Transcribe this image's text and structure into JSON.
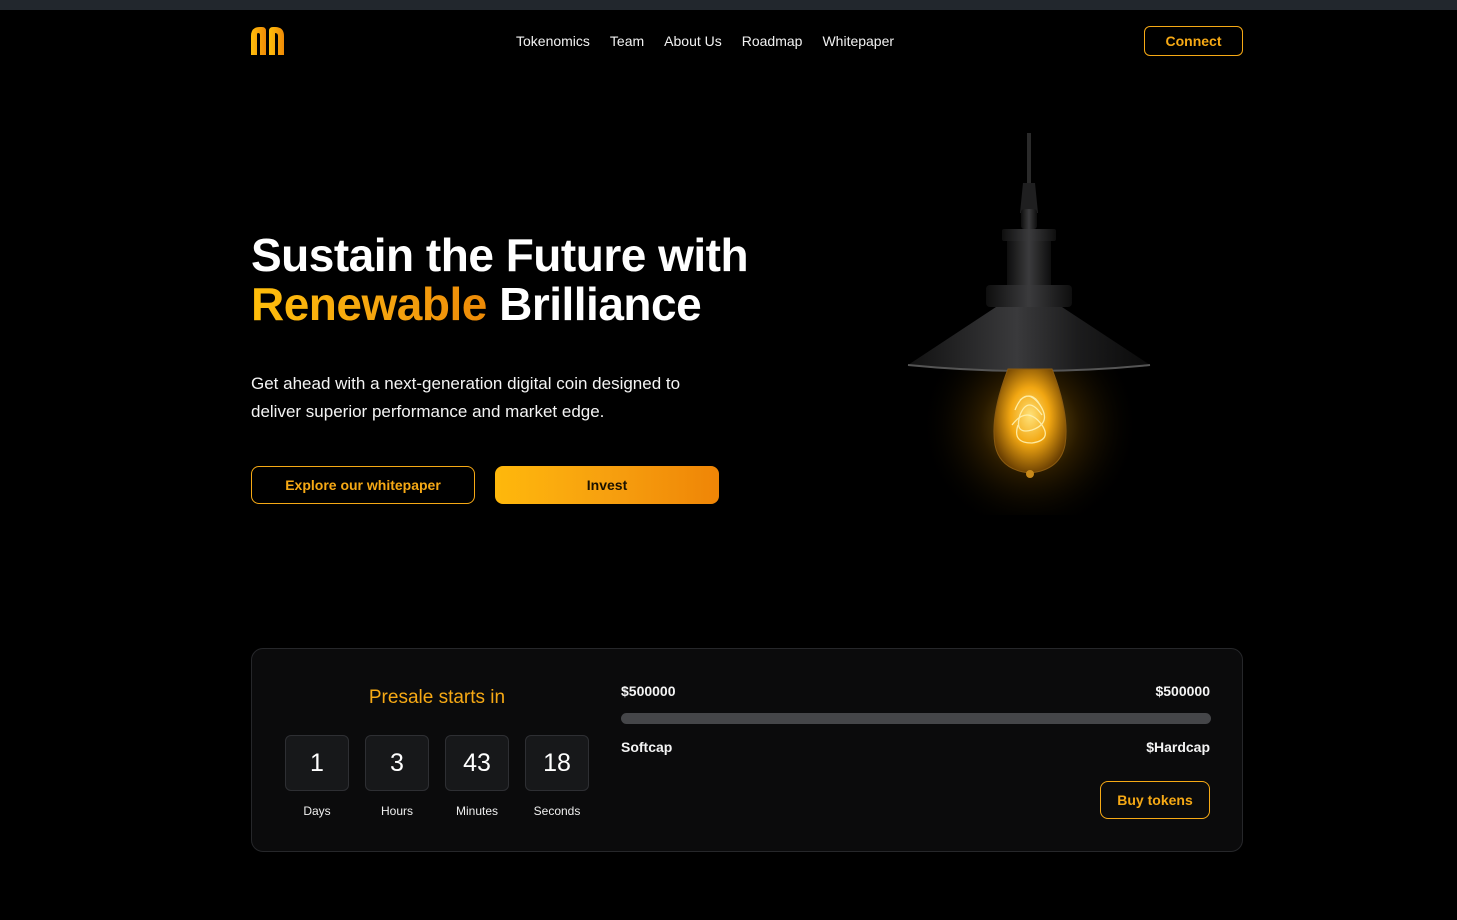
{
  "brand": {
    "logo_icon": "brand-logo-icon",
    "accent_color": "#f6a915"
  },
  "nav": {
    "links": [
      "Tokenomics",
      "Team",
      "About Us",
      "Roadmap",
      "Whitepaper"
    ],
    "connect_label": "Connect"
  },
  "hero": {
    "title_line1": "Sustain the Future with",
    "title_accent": "Renewable",
    "title_rest": " Brilliance",
    "subtitle": "Get ahead with a next-generation digital coin designed to deliver superior performance and market edge.",
    "explore_label": "Explore our whitepaper",
    "invest_label": "Invest",
    "illustration": "pendant-lamp-bulb"
  },
  "presale": {
    "title": "Presale starts in",
    "countdown": [
      {
        "value": "1",
        "label": "Days"
      },
      {
        "value": "3",
        "label": "Hours"
      },
      {
        "value": "43",
        "label": "Minutes"
      },
      {
        "value": "18",
        "label": "Seconds"
      }
    ],
    "softcap_amount": "$500000",
    "hardcap_amount": "$500000",
    "softcap_label": "Softcap",
    "hardcap_label": "$Hardcap",
    "progress": 0,
    "buy_label": "Buy tokens"
  }
}
